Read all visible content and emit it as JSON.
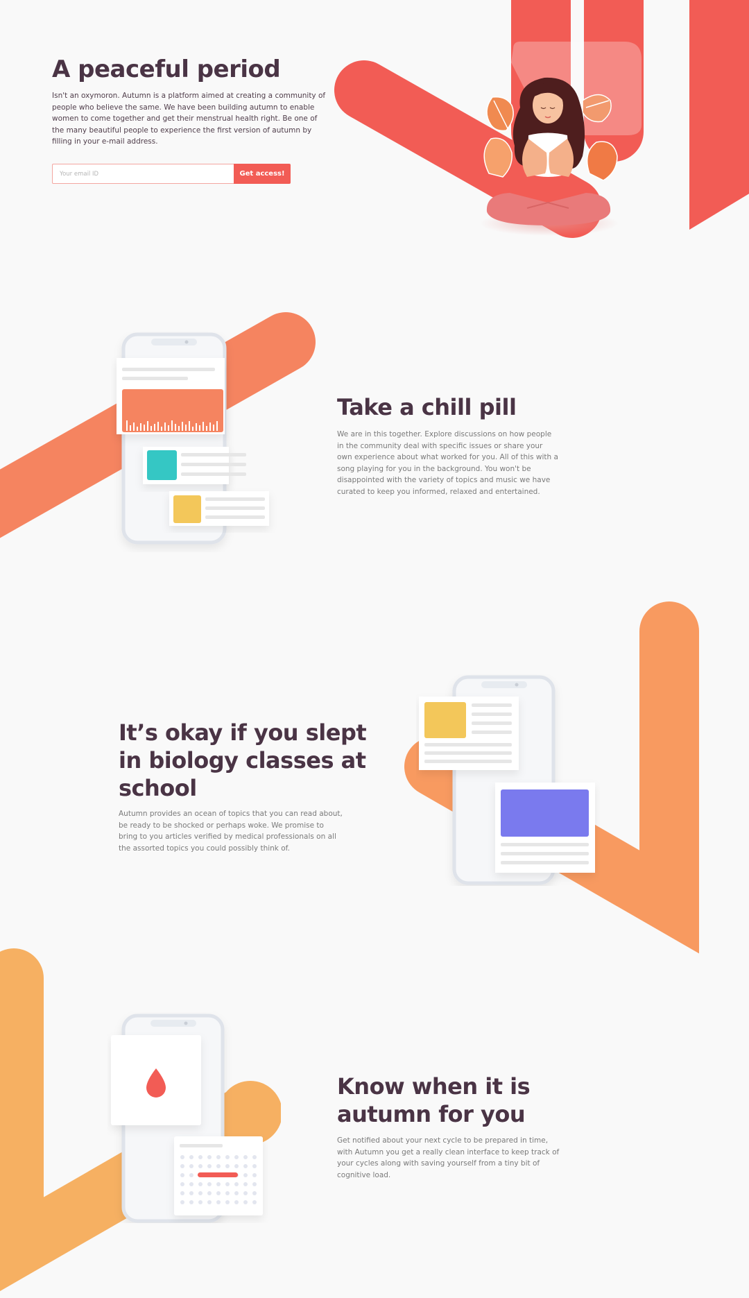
{
  "hero": {
    "title": "A peaceful period",
    "body": "Isn't an oxymoron. Autumn is a platform aimed at creating a community of people who believe the same. We have been building autumn to enable women to come together and get their menstrual health right. Be one of the many beautiful people to experience the first version of autumn by filling in your e-mail address.",
    "email_placeholder": "Your email ID",
    "cta_label": "Get access!"
  },
  "section_chill": {
    "title": "Take a chill pill",
    "body": "We are in this together. Explore discussions on how people in the community deal with specific issues or share your own experience about what worked for you. All of this with a song playing for you in the background. You won't be disappointed with the variety of topics and music we have curated to keep you informed, relaxed and entertained."
  },
  "section_biology": {
    "title_line1": "It’s okay if you slept",
    "title_line2": "in biology classes at",
    "title_line3": "school",
    "body": "Autumn provides an ocean of topics that you can read about, be ready to be shocked or perhaps woke. We promise to bring to you articles verified by medical professionals on all the assorted topics you could possibly think of."
  },
  "section_autumn": {
    "title_line1": "Know when it is",
    "title_line2": "autumn for you",
    "body": "Get notified about your next cycle to be prepared in time, with Autumn you get a really clean interface to keep track of your cycles along with saving yourself from a tiny bit of cognitive load."
  },
  "colors": {
    "red": "#f25c55",
    "coral": "#f58460",
    "orange": "#f89a60",
    "amber": "#f6b062",
    "heading": "#4a3445"
  },
  "icons": {
    "drop": "drop-icon"
  }
}
